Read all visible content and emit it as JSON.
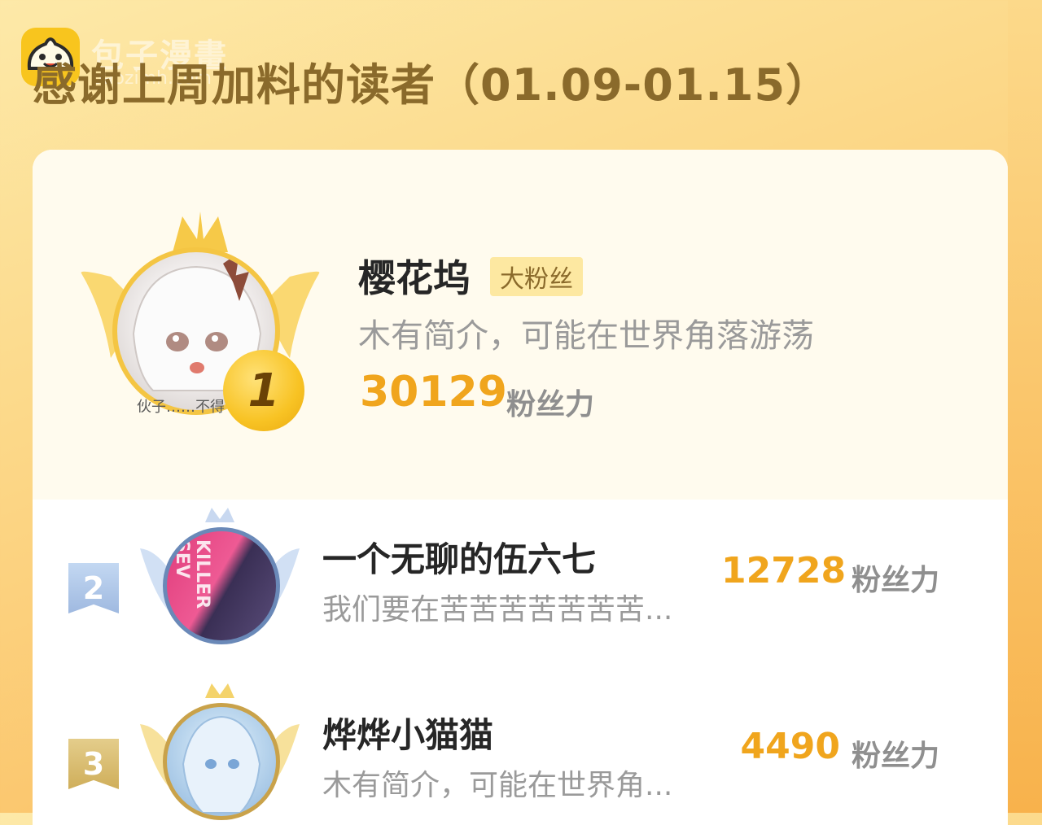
{
  "watermark": {
    "text": "包子漫畫",
    "url": "baozimh.com"
  },
  "title": "感谢上周加料的读者（01.09-01.15）",
  "leaderboard": {
    "first": {
      "rank": "1",
      "name": "樱花坞",
      "tag": "大粉丝",
      "bio": "木有简介，可能在世界角落游荡",
      "points": "30129",
      "points_unit": "粉丝力",
      "avatar_caption": "伙子……不得"
    },
    "rows": [
      {
        "rank": "2",
        "name": "一个无聊的伍六七",
        "bio": "我们要在苦苦苦苦苦苦苦...",
        "points": "12728",
        "points_unit": "粉丝力",
        "avatar_text": "KILLER SEV"
      },
      {
        "rank": "3",
        "name": "烨烨小猫猫",
        "bio": "木有简介，可能在世界角...",
        "points": "4490",
        "points_unit": "粉丝力"
      }
    ]
  },
  "colors": {
    "accent": "#f0a51d",
    "title": "#8a6a2b",
    "gold": "#f4c543",
    "silver": "#a9c3e6",
    "bronze": "#d8b767"
  }
}
